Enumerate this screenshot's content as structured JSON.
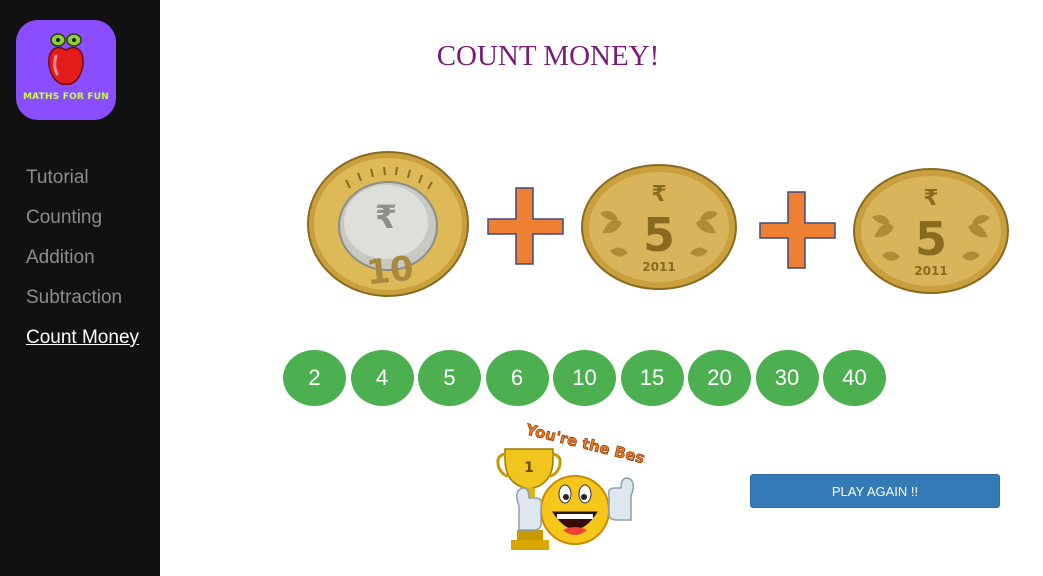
{
  "app": {
    "logo_text": "MATHS FOR FUN"
  },
  "sidebar": {
    "items": [
      {
        "label": "Tutorial",
        "active": false
      },
      {
        "label": "Counting",
        "active": false
      },
      {
        "label": "Addition",
        "active": false
      },
      {
        "label": "Subtraction",
        "active": false
      },
      {
        "label": "Count Money",
        "active": true
      }
    ]
  },
  "main": {
    "title": "COUNT MONEY!",
    "coins": [
      {
        "denomination": "10",
        "symbol": "₹"
      },
      {
        "denomination": "5",
        "symbol": "₹",
        "year": "2011"
      },
      {
        "denomination": "5",
        "symbol": "₹",
        "year": "2011"
      }
    ],
    "operator": "+",
    "answers": [
      "2",
      "4",
      "5",
      "6",
      "10",
      "15",
      "20",
      "30",
      "40"
    ],
    "reward": {
      "text": "You're the Best!",
      "trophy_rank": "1"
    },
    "play_again_label": "PLAY AGAIN !!"
  },
  "colors": {
    "sidebar_bg": "#111111",
    "logo_bg": "#8a4dff",
    "title": "#7a1a7a",
    "answer_bg": "#4caf50",
    "plus": "#ee8033",
    "button_bg": "#337ab7"
  }
}
